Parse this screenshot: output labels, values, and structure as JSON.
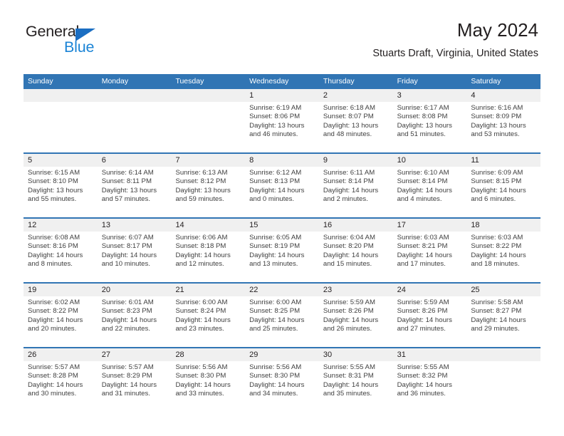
{
  "brand": {
    "name_part1": "General",
    "name_part2": "Blue",
    "accent_color": "#1b84d6",
    "triangle_color": "#1b6ec2"
  },
  "header": {
    "title": "May 2024",
    "subtitle": "Stuarts Draft, Virginia, United States"
  },
  "theme": {
    "header_blue": "#3175b4",
    "daynum_band_gray": "#f0f0f0",
    "text_color": "#231f20"
  },
  "weekdays": [
    "Sunday",
    "Monday",
    "Tuesday",
    "Wednesday",
    "Thursday",
    "Friday",
    "Saturday"
  ],
  "weeks": [
    [
      {
        "day": "",
        "lines": [
          "",
          "",
          "",
          ""
        ]
      },
      {
        "day": "",
        "lines": [
          "",
          "",
          "",
          ""
        ]
      },
      {
        "day": "",
        "lines": [
          "",
          "",
          "",
          ""
        ]
      },
      {
        "day": "1",
        "lines": [
          "Sunrise: 6:19 AM",
          "Sunset: 8:06 PM",
          "Daylight: 13 hours",
          "and 46 minutes."
        ]
      },
      {
        "day": "2",
        "lines": [
          "Sunrise: 6:18 AM",
          "Sunset: 8:07 PM",
          "Daylight: 13 hours",
          "and 48 minutes."
        ]
      },
      {
        "day": "3",
        "lines": [
          "Sunrise: 6:17 AM",
          "Sunset: 8:08 PM",
          "Daylight: 13 hours",
          "and 51 minutes."
        ]
      },
      {
        "day": "4",
        "lines": [
          "Sunrise: 6:16 AM",
          "Sunset: 8:09 PM",
          "Daylight: 13 hours",
          "and 53 minutes."
        ]
      }
    ],
    [
      {
        "day": "5",
        "lines": [
          "Sunrise: 6:15 AM",
          "Sunset: 8:10 PM",
          "Daylight: 13 hours",
          "and 55 minutes."
        ]
      },
      {
        "day": "6",
        "lines": [
          "Sunrise: 6:14 AM",
          "Sunset: 8:11 PM",
          "Daylight: 13 hours",
          "and 57 minutes."
        ]
      },
      {
        "day": "7",
        "lines": [
          "Sunrise: 6:13 AM",
          "Sunset: 8:12 PM",
          "Daylight: 13 hours",
          "and 59 minutes."
        ]
      },
      {
        "day": "8",
        "lines": [
          "Sunrise: 6:12 AM",
          "Sunset: 8:13 PM",
          "Daylight: 14 hours",
          "and 0 minutes."
        ]
      },
      {
        "day": "9",
        "lines": [
          "Sunrise: 6:11 AM",
          "Sunset: 8:14 PM",
          "Daylight: 14 hours",
          "and 2 minutes."
        ]
      },
      {
        "day": "10",
        "lines": [
          "Sunrise: 6:10 AM",
          "Sunset: 8:14 PM",
          "Daylight: 14 hours",
          "and 4 minutes."
        ]
      },
      {
        "day": "11",
        "lines": [
          "Sunrise: 6:09 AM",
          "Sunset: 8:15 PM",
          "Daylight: 14 hours",
          "and 6 minutes."
        ]
      }
    ],
    [
      {
        "day": "12",
        "lines": [
          "Sunrise: 6:08 AM",
          "Sunset: 8:16 PM",
          "Daylight: 14 hours",
          "and 8 minutes."
        ]
      },
      {
        "day": "13",
        "lines": [
          "Sunrise: 6:07 AM",
          "Sunset: 8:17 PM",
          "Daylight: 14 hours",
          "and 10 minutes."
        ]
      },
      {
        "day": "14",
        "lines": [
          "Sunrise: 6:06 AM",
          "Sunset: 8:18 PM",
          "Daylight: 14 hours",
          "and 12 minutes."
        ]
      },
      {
        "day": "15",
        "lines": [
          "Sunrise: 6:05 AM",
          "Sunset: 8:19 PM",
          "Daylight: 14 hours",
          "and 13 minutes."
        ]
      },
      {
        "day": "16",
        "lines": [
          "Sunrise: 6:04 AM",
          "Sunset: 8:20 PM",
          "Daylight: 14 hours",
          "and 15 minutes."
        ]
      },
      {
        "day": "17",
        "lines": [
          "Sunrise: 6:03 AM",
          "Sunset: 8:21 PM",
          "Daylight: 14 hours",
          "and 17 minutes."
        ]
      },
      {
        "day": "18",
        "lines": [
          "Sunrise: 6:03 AM",
          "Sunset: 8:22 PM",
          "Daylight: 14 hours",
          "and 18 minutes."
        ]
      }
    ],
    [
      {
        "day": "19",
        "lines": [
          "Sunrise: 6:02 AM",
          "Sunset: 8:22 PM",
          "Daylight: 14 hours",
          "and 20 minutes."
        ]
      },
      {
        "day": "20",
        "lines": [
          "Sunrise: 6:01 AM",
          "Sunset: 8:23 PM",
          "Daylight: 14 hours",
          "and 22 minutes."
        ]
      },
      {
        "day": "21",
        "lines": [
          "Sunrise: 6:00 AM",
          "Sunset: 8:24 PM",
          "Daylight: 14 hours",
          "and 23 minutes."
        ]
      },
      {
        "day": "22",
        "lines": [
          "Sunrise: 6:00 AM",
          "Sunset: 8:25 PM",
          "Daylight: 14 hours",
          "and 25 minutes."
        ]
      },
      {
        "day": "23",
        "lines": [
          "Sunrise: 5:59 AM",
          "Sunset: 8:26 PM",
          "Daylight: 14 hours",
          "and 26 minutes."
        ]
      },
      {
        "day": "24",
        "lines": [
          "Sunrise: 5:59 AM",
          "Sunset: 8:26 PM",
          "Daylight: 14 hours",
          "and 27 minutes."
        ]
      },
      {
        "day": "25",
        "lines": [
          "Sunrise: 5:58 AM",
          "Sunset: 8:27 PM",
          "Daylight: 14 hours",
          "and 29 minutes."
        ]
      }
    ],
    [
      {
        "day": "26",
        "lines": [
          "Sunrise: 5:57 AM",
          "Sunset: 8:28 PM",
          "Daylight: 14 hours",
          "and 30 minutes."
        ]
      },
      {
        "day": "27",
        "lines": [
          "Sunrise: 5:57 AM",
          "Sunset: 8:29 PM",
          "Daylight: 14 hours",
          "and 31 minutes."
        ]
      },
      {
        "day": "28",
        "lines": [
          "Sunrise: 5:56 AM",
          "Sunset: 8:30 PM",
          "Daylight: 14 hours",
          "and 33 minutes."
        ]
      },
      {
        "day": "29",
        "lines": [
          "Sunrise: 5:56 AM",
          "Sunset: 8:30 PM",
          "Daylight: 14 hours",
          "and 34 minutes."
        ]
      },
      {
        "day": "30",
        "lines": [
          "Sunrise: 5:55 AM",
          "Sunset: 8:31 PM",
          "Daylight: 14 hours",
          "and 35 minutes."
        ]
      },
      {
        "day": "31",
        "lines": [
          "Sunrise: 5:55 AM",
          "Sunset: 8:32 PM",
          "Daylight: 14 hours",
          "and 36 minutes."
        ]
      },
      {
        "day": "",
        "lines": [
          "",
          "",
          "",
          ""
        ]
      }
    ]
  ]
}
